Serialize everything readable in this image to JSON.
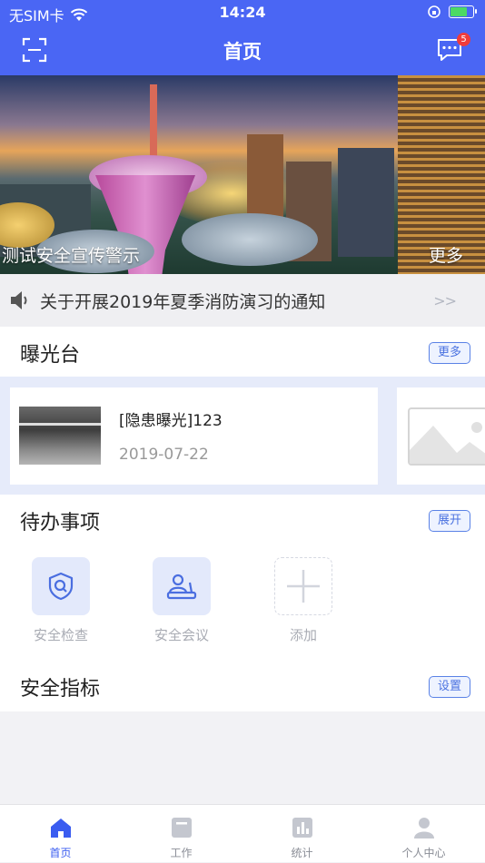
{
  "status_bar": {
    "carrier": "无SIM卡",
    "time": "14:24"
  },
  "navbar": {
    "title": "首页",
    "message_badge": "5",
    "accent": "#4a66f4"
  },
  "banner": {
    "caption": "测试安全宣传警示",
    "more": "更多"
  },
  "notice": {
    "text": "关于开展2019年夏季消防演习的通知",
    "arrow": ">>"
  },
  "exposure": {
    "heading": "曝光台",
    "more_label": "更多",
    "items": [
      {
        "title": "[隐患曝光]123",
        "date": "2019-07-22"
      }
    ]
  },
  "todo": {
    "heading": "待办事项",
    "toggle_label": "展开",
    "items": [
      {
        "label": "安全检查",
        "icon": "shield-search-icon"
      },
      {
        "label": "安全会议",
        "icon": "meeting-icon"
      },
      {
        "label": "添加",
        "icon": "plus-icon"
      }
    ]
  },
  "indicators": {
    "heading": "安全指标",
    "settings_label": "设置"
  },
  "tabbar": {
    "active": "home",
    "items": [
      {
        "label": "首页",
        "icon": "home-icon"
      },
      {
        "label": "工作",
        "icon": "work-icon"
      },
      {
        "label": "统计",
        "icon": "chart-icon"
      },
      {
        "label": "个人中心",
        "icon": "user-icon"
      }
    ]
  }
}
